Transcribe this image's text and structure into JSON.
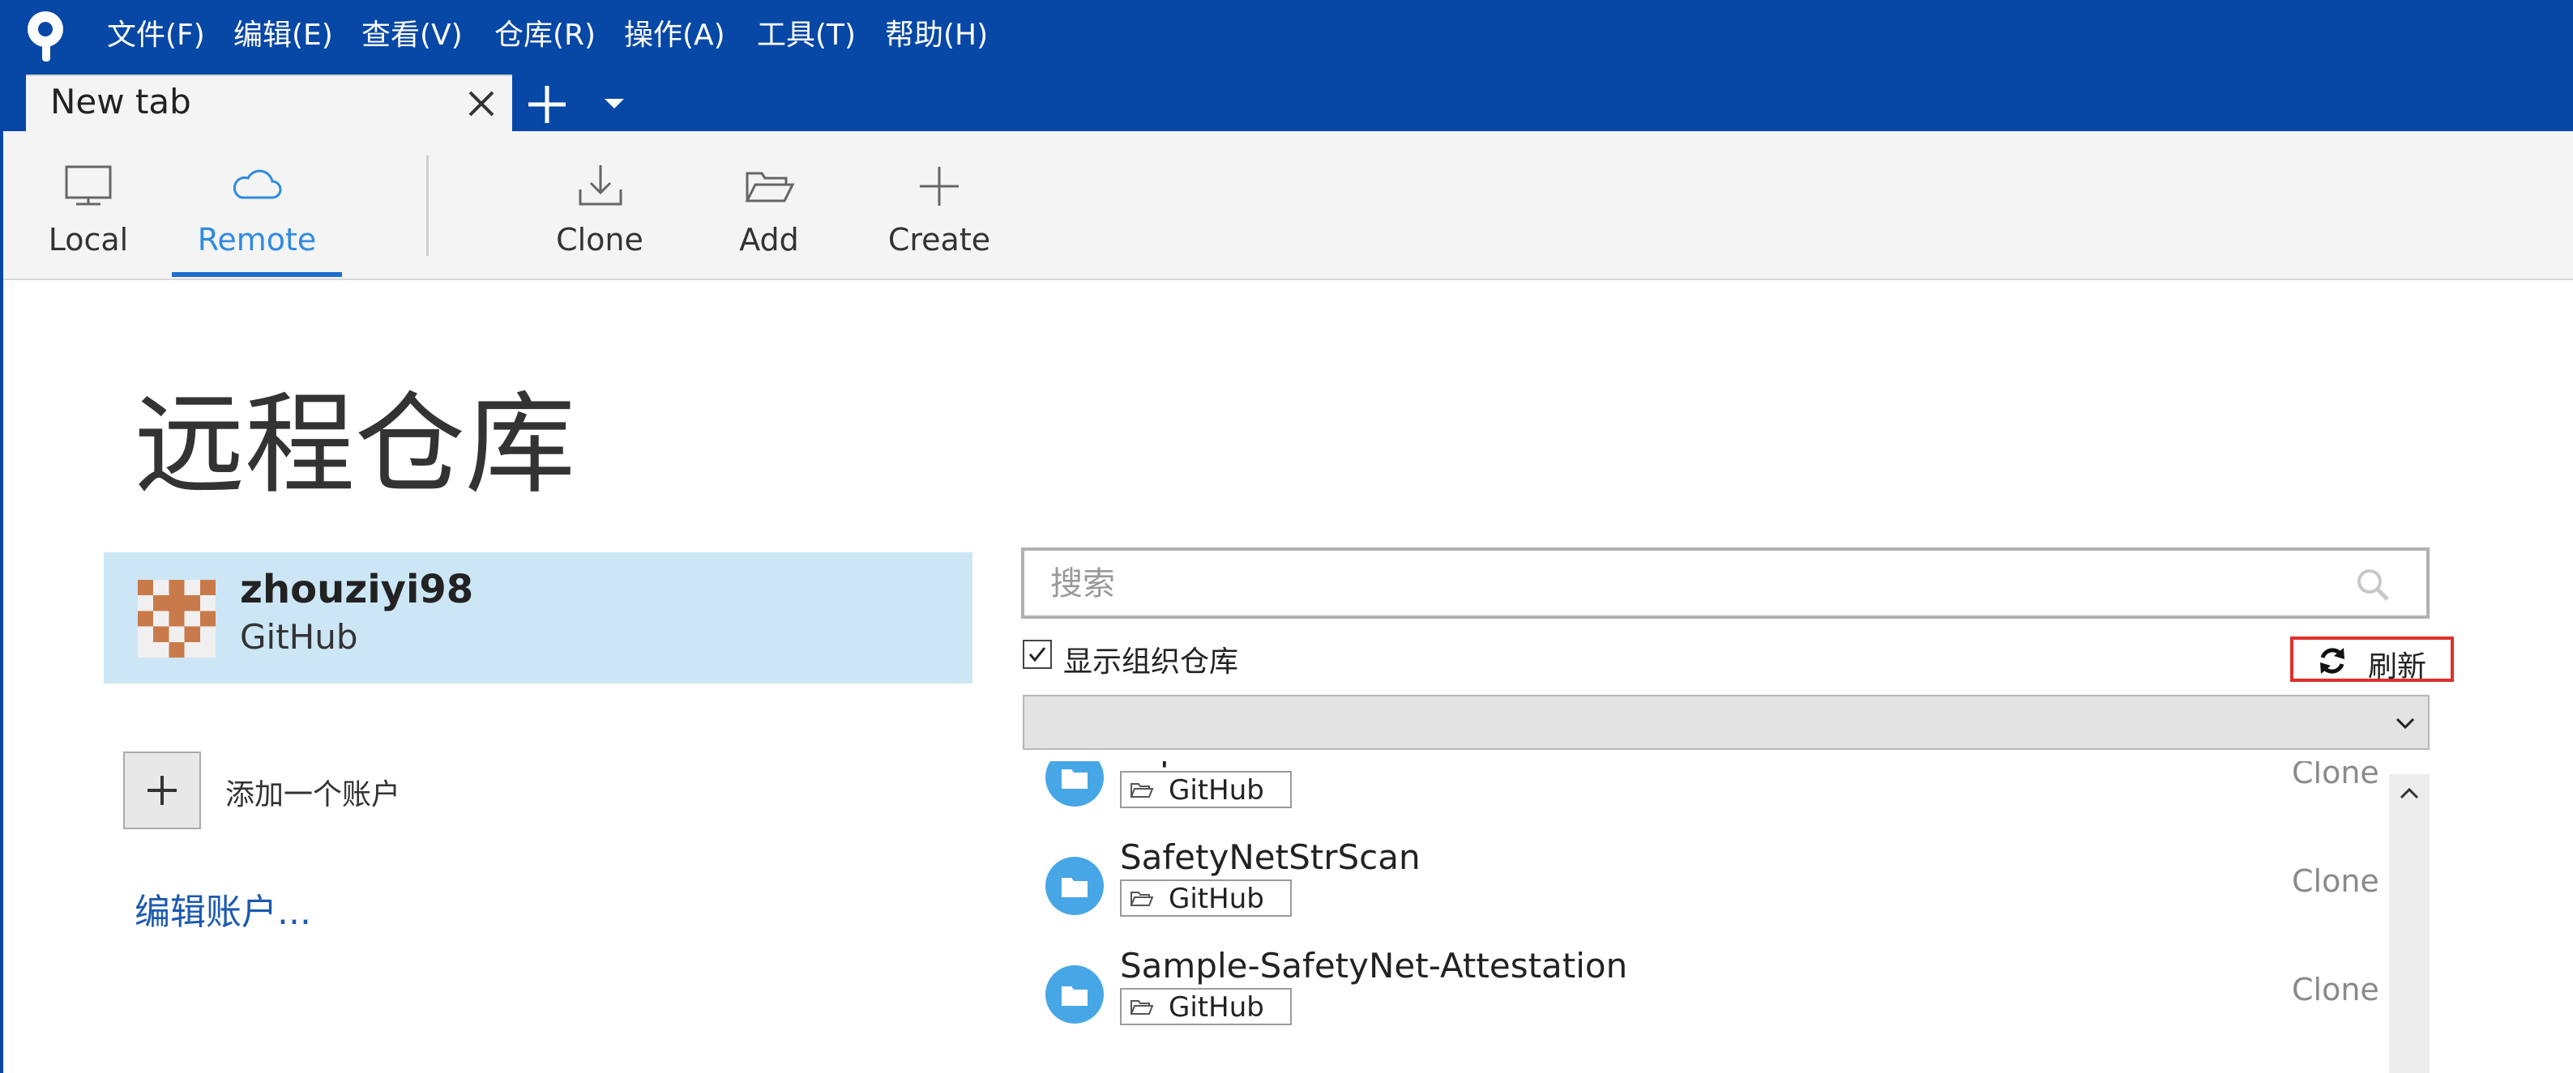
{
  "colors": {
    "titlebar": "#0747a6",
    "accent": "#2f8ae0",
    "account_card": "#cce6f5",
    "refresh_border": "#e0302a",
    "link": "#1c59b0",
    "folder_icon": "#47a6e6"
  },
  "menu": [
    {
      "label": "文件(F)"
    },
    {
      "label": "编辑(E)"
    },
    {
      "label": "查看(V)"
    },
    {
      "label": "仓库(R)"
    },
    {
      "label": "操作(A)"
    },
    {
      "label": "工具(T)"
    },
    {
      "label": "帮助(H)"
    }
  ],
  "tabs": {
    "active_title": "New tab"
  },
  "toolbar": {
    "local": "Local",
    "remote": "Remote",
    "clone": "Clone",
    "add": "Add",
    "create": "Create",
    "selected": "Remote"
  },
  "page": {
    "title": "远程仓库"
  },
  "account": {
    "username": "zhouziyi98",
    "service": "GitHub",
    "add_account_label": "添加一个账户",
    "edit_accounts_link": "编辑账户..."
  },
  "search": {
    "placeholder": "搜索",
    "value": ""
  },
  "filters": {
    "show_org_label": "显示组织仓库",
    "show_org_checked": true,
    "refresh_label": "刷新",
    "dropdown_value": ""
  },
  "repositories": [
    {
      "name": "PaperNotes",
      "host": "GitHub",
      "action": "Clone"
    },
    {
      "name": "SafetyNetStrScan",
      "host": "GitHub",
      "action": "Clone"
    },
    {
      "name": "Sample-SafetyNet-Attestation",
      "host": "GitHub",
      "action": "Clone"
    }
  ]
}
